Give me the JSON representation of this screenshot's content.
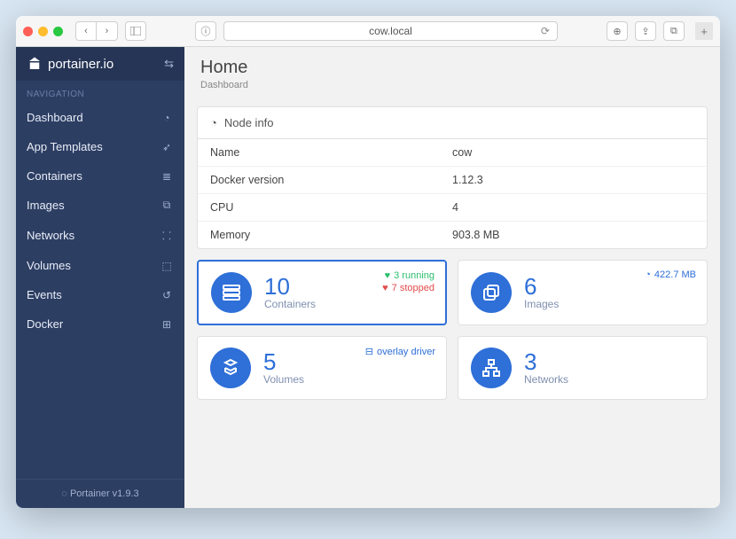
{
  "browser": {
    "url_display": "cow.local"
  },
  "brand": {
    "name": "portainer.io"
  },
  "sidebar": {
    "section_label": "NAVIGATION",
    "items": [
      {
        "label": "Dashboard",
        "icon": "gauge"
      },
      {
        "label": "App Templates",
        "icon": "rocket"
      },
      {
        "label": "Containers",
        "icon": "server"
      },
      {
        "label": "Images",
        "icon": "clone"
      },
      {
        "label": "Networks",
        "icon": "sitemap"
      },
      {
        "label": "Volumes",
        "icon": "cubes"
      },
      {
        "label": "Events",
        "icon": "history"
      },
      {
        "label": "Docker",
        "icon": "grid"
      }
    ],
    "footer": "Portainer v1.9.3"
  },
  "page": {
    "title": "Home",
    "subtitle": "Dashboard"
  },
  "node_info": {
    "card_title": "Node info",
    "rows": [
      {
        "k": "Name",
        "v": "cow"
      },
      {
        "k": "Docker version",
        "v": "1.12.3"
      },
      {
        "k": "CPU",
        "v": "4"
      },
      {
        "k": "Memory",
        "v": "903.8 MB"
      }
    ]
  },
  "tiles": {
    "containers": {
      "count": "10",
      "label": "Containers",
      "running": "3 running",
      "stopped": "7 stopped"
    },
    "images": {
      "count": "6",
      "label": "Images",
      "size": "422.7 MB"
    },
    "volumes": {
      "count": "5",
      "label": "Volumes",
      "driver": "overlay driver"
    },
    "networks": {
      "count": "3",
      "label": "Networks"
    }
  }
}
